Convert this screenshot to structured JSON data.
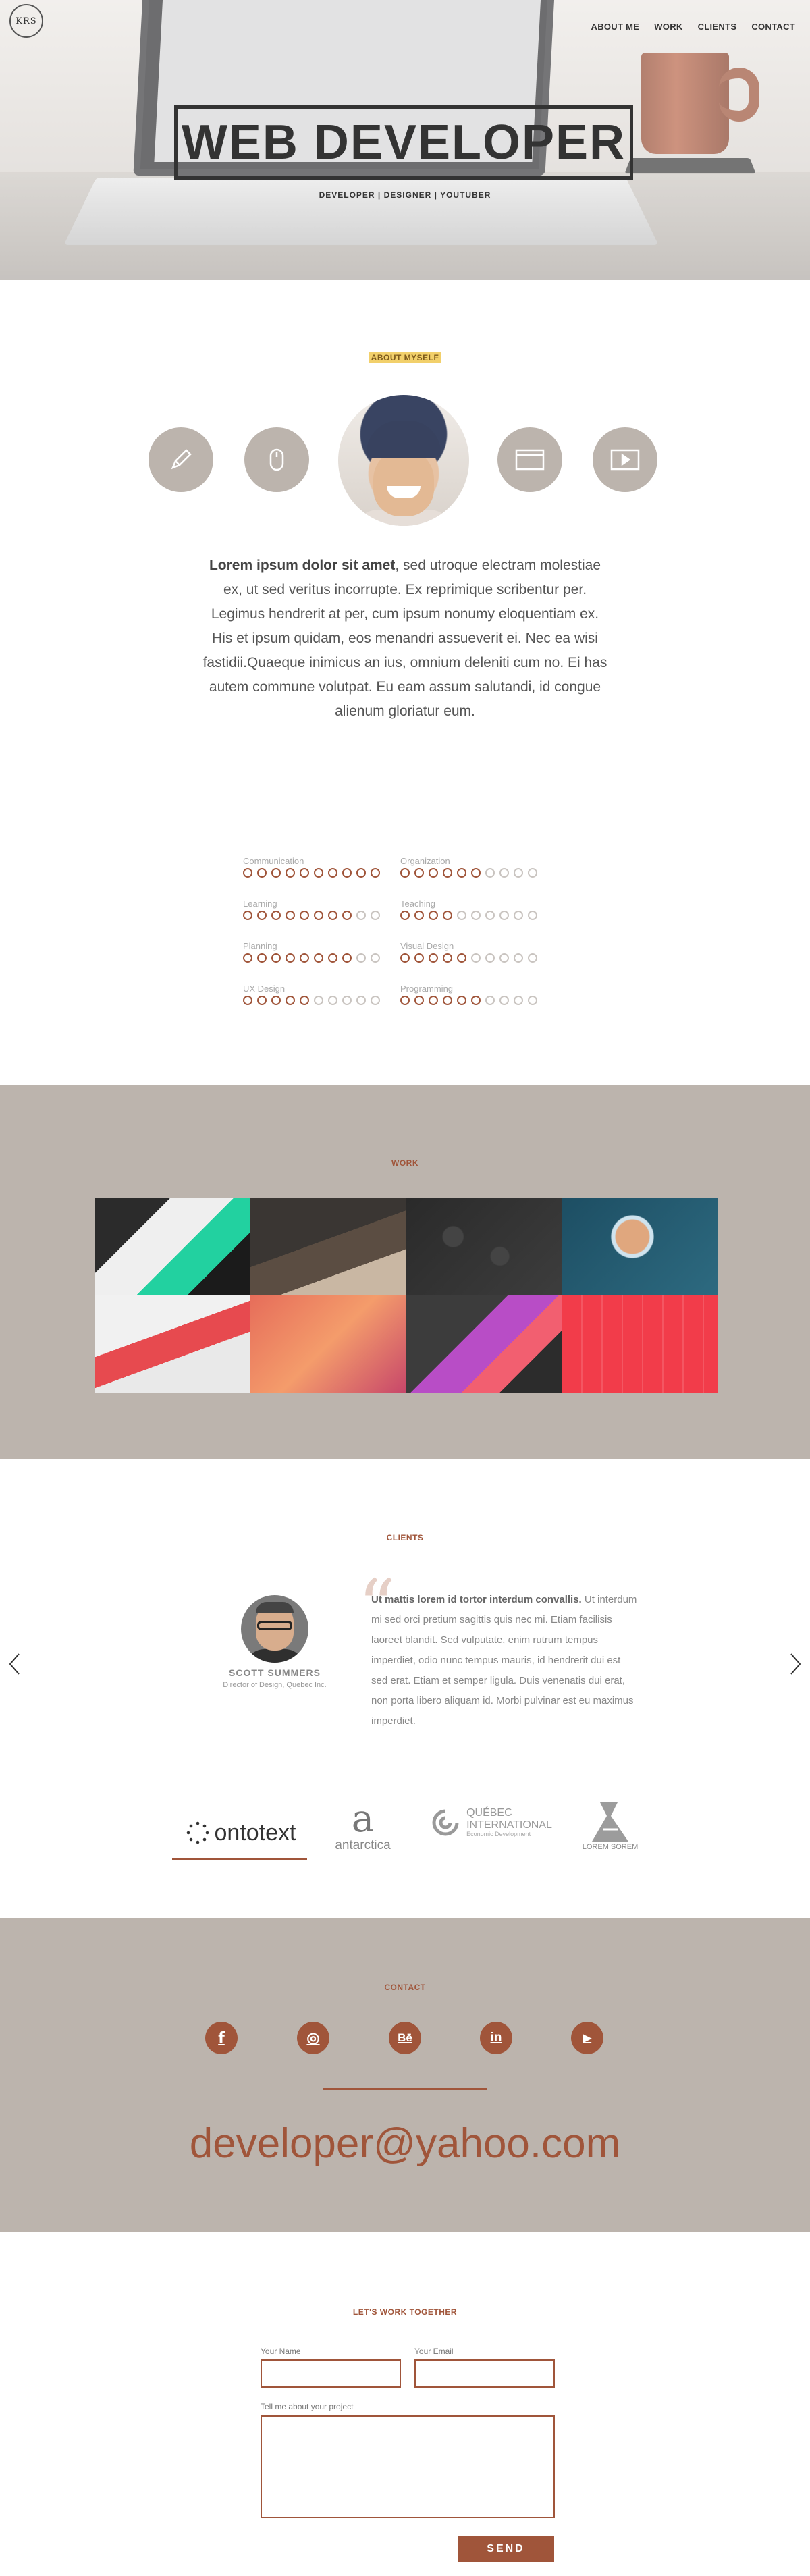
{
  "brand": {
    "logo_text": "KRS"
  },
  "nav": {
    "items": [
      {
        "label": "ABOUT ME"
      },
      {
        "label": "WORK"
      },
      {
        "label": "CLIENTS"
      },
      {
        "label": "CONTACT"
      }
    ]
  },
  "hero": {
    "title": "WEB DEVELOPER",
    "subtitle": "DEVELOPER | DESIGNER | YOUTUBER"
  },
  "about": {
    "heading": "ABOUT MYSELF",
    "icons": [
      "pencil-icon",
      "mouse-icon",
      "browser-window-icon",
      "video-play-icon"
    ],
    "text_bold": "Lorem ipsum dolor sit amet",
    "text_rest": ", sed utroque electram molestiae ex, ut sed veritus incorrupte. Ex reprimique scribentur per. Legimus hendrerit at per, cum ipsum nonumy eloquentiam ex. His et ipsum quidam, eos menandri assueverit ei. Nec ea wisi fastidii.Quaeque inimicus an ius, omnium deleniti cum no. Ei has autem commune volutpat. Eu eam assum salutandi, id congue alienum gloriatur eum."
  },
  "skills": [
    {
      "label": "Communication",
      "level": 10,
      "max": 10
    },
    {
      "label": "Organization",
      "level": 6,
      "max": 10
    },
    {
      "label": "Learning",
      "level": 8,
      "max": 10
    },
    {
      "label": "Teaching",
      "level": 4,
      "max": 10
    },
    {
      "label": "Planning",
      "level": 8,
      "max": 10
    },
    {
      "label": "Visual Design",
      "level": 5,
      "max": 10
    },
    {
      "label": "UX Design",
      "level": 5,
      "max": 10
    },
    {
      "label": "Programming",
      "level": 6,
      "max": 10
    }
  ],
  "work": {
    "heading": "WORK"
  },
  "clients": {
    "heading": "CLIENTS",
    "name": "SCOTT SUMMERS",
    "role": "Director of Design, Quebec Inc.",
    "quote_bold": "Ut mattis lorem id tortor interdum convallis.",
    "quote_rest": " Ut interdum mi sed orci pretium sagittis quis nec mi. Etiam facilisis laoreet blandit. Sed vulputate, enim rutrum tempus imperdiet, odio nunc tempus mauris, id hendrerit dui est sed erat. Etiam et semper ligula. Duis venenatis dui erat, non porta libero aliquam id. Morbi pulvinar est eu maximus imperdiet.",
    "logos": {
      "ontotext": "ontotext",
      "antarctica": "antarctica",
      "quebec_line1": "QUÉBEC",
      "quebec_line2": "INTERNATIONAL",
      "quebec_line3": "Economic Development",
      "loremsorem": "LOREM SOREM"
    }
  },
  "contact": {
    "heading": "CONTACT",
    "socials": [
      {
        "icon": "facebook-icon",
        "glyph": "f"
      },
      {
        "icon": "dribbble-icon",
        "glyph": "◎"
      },
      {
        "icon": "behance-icon",
        "glyph": "Bē"
      },
      {
        "icon": "linkedin-icon",
        "glyph": "in"
      },
      {
        "icon": "youtube-icon",
        "glyph": "▶"
      }
    ],
    "email": "developer@yahoo.com"
  },
  "form": {
    "heading": "LET'S WORK TOGETHER",
    "name_label": "Your Name",
    "email_label": "Your Email",
    "message_label": "Tell me about your project",
    "send_label": "SEND"
  },
  "colors": {
    "accent": "#a0553a",
    "panel": "#bcb4ad",
    "highlight": "#f2d06b"
  }
}
